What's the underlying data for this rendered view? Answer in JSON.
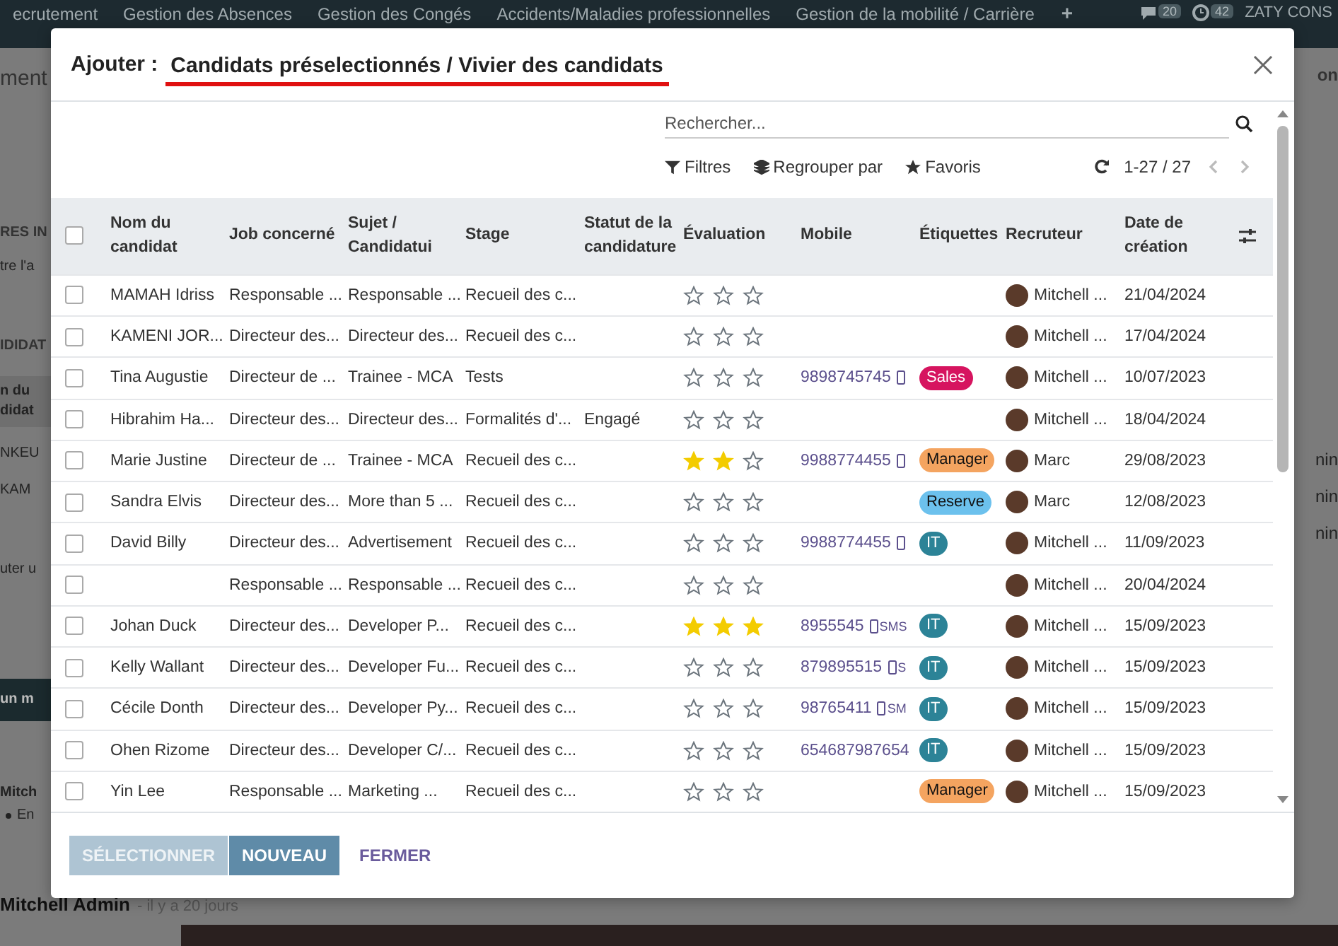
{
  "top_nav": {
    "items": [
      "ecrutement",
      "Gestion des Absences",
      "Gestion des Congés",
      "Accidents/Maladies professionnelles",
      "Gestion de la mobilité / Carrière"
    ],
    "add": "+",
    "messages_count": "20",
    "activities_count": "42",
    "company": "ZATY CONS"
  },
  "background": {
    "left_fragments": [
      {
        "kind": "title",
        "text": "ment"
      },
      {
        "kind": "heading",
        "text": "RES IN"
      },
      {
        "kind": "text",
        "text": "tre l'a"
      },
      {
        "kind": "heading",
        "text": "IDIDAT"
      },
      {
        "kind": "header",
        "text": "n du didat"
      },
      {
        "kind": "text",
        "text": "NKEU"
      },
      {
        "kind": "text",
        "text": "KAM"
      },
      {
        "kind": "text",
        "text": "uter u"
      },
      {
        "kind": "bar",
        "text": "un m"
      },
      {
        "kind": "author",
        "text": "Mitch"
      },
      {
        "kind": "bullet",
        "text": "En"
      }
    ],
    "right_fragments": [
      {
        "kind": "title",
        "text": "on"
      },
      {
        "kind": "text",
        "text": "nin"
      },
      {
        "kind": "text",
        "text": "nin"
      },
      {
        "kind": "text",
        "text": "nin"
      }
    ],
    "footer_author": "Mitchell Admin",
    "footer_time": "- il y a 20 jours"
  },
  "dialog": {
    "title_prefix": "Ajouter :",
    "title": "Candidats préselectionnés / Vivier des candidats",
    "search": {
      "placeholder": "Rechercher..."
    },
    "filters": [
      "Filtres",
      "Regrouper par",
      "Favoris"
    ],
    "pager": "1-27 / 27",
    "table": {
      "all_checked": false,
      "columns": [
        "Nom du candidat",
        "Job concerné",
        "Sujet / Candidatui",
        "Stage",
        "Statut de la candidature",
        "Évaluation",
        "Mobile",
        "Étiquettes",
        "Recruteur",
        "Date de création"
      ],
      "rows": [
        {
          "checked": false,
          "name": "MAMAH Idriss",
          "job": "Responsable ...",
          "subject": "Responsable ...",
          "stage": "Recueil des c...",
          "stars": 0,
          "recruiter": "Mitchell ...",
          "date": "21/04/2024"
        },
        {
          "checked": false,
          "name": "KAMENI JOR...",
          "job": "Directeur des...",
          "subject": "Directeur des...",
          "stage": "Recueil des c...",
          "stars": 0,
          "recruiter": "Mitchell ...",
          "date": "17/04/2024"
        },
        {
          "checked": false,
          "name": "Tina Augustie",
          "job": "Directeur de ...",
          "subject": "Trainee - MCA",
          "stage": "Tests",
          "stars": 0,
          "mobile": "9898745745",
          "phone_icon": true,
          "tag": {
            "label": "Sales",
            "color": "#d6145f"
          },
          "recruiter": "Mitchell ...",
          "date": "10/07/2023"
        },
        {
          "checked": false,
          "name": "Hibrahim Ha...",
          "job": "Directeur des...",
          "subject": "Directeur des...",
          "stage": "Formalités d'...",
          "status": "Engagé",
          "stars": 0,
          "recruiter": "Mitchell ...",
          "date": "18/04/2024"
        },
        {
          "checked": false,
          "name": "Marie Justine",
          "job": "Directeur de ...",
          "subject": "Trainee - MCA",
          "stage": "Recueil des c...",
          "stars": 2,
          "mobile": "9988774455",
          "phone_icon": true,
          "tag": {
            "label": "Manager",
            "color": "#f4a460"
          },
          "recruiter": "Marc",
          "date": "29/08/2023"
        },
        {
          "checked": false,
          "name": "Sandra Elvis",
          "job": "Directeur des...",
          "subject": "More than 5 ...",
          "stage": "Recueil des c...",
          "stars": 0,
          "tag": {
            "label": "Reserve",
            "color": "#6cc1ed"
          },
          "recruiter": "Marc",
          "date": "12/08/2023"
        },
        {
          "checked": false,
          "name": "David Billy",
          "job": "Directeur des...",
          "subject": "Advertisement",
          "stage": "Recueil des c...",
          "stars": 0,
          "mobile": "9988774455",
          "phone_icon": true,
          "tag": {
            "label": "IT",
            "color": "#2c8397"
          },
          "recruiter": "Mitchell ...",
          "date": "11/09/2023"
        },
        {
          "checked": false,
          "job": "Responsable ...",
          "subject": "Responsable ...",
          "stage": "Recueil des c...",
          "stars": 0,
          "recruiter": "Mitchell ...",
          "date": "20/04/2024"
        },
        {
          "checked": false,
          "name": "Johan Duck",
          "job": "Directeur des...",
          "subject": "Developer P...",
          "stage": "Recueil des c...",
          "stars": 3,
          "mobile": "8955545",
          "phone_icon": true,
          "sms": "SMS",
          "tag": {
            "label": "IT",
            "color": "#2c8397"
          },
          "recruiter": "Mitchell ...",
          "date": "15/09/2023"
        },
        {
          "checked": false,
          "name": "Kelly Wallant",
          "job": "Directeur des...",
          "subject": "Developer Fu...",
          "stage": "Recueil des c...",
          "stars": 0,
          "mobile": "879895515",
          "phone_icon": true,
          "sms": "S",
          "tag": {
            "label": "IT",
            "color": "#2c8397"
          },
          "recruiter": "Mitchell ...",
          "date": "15/09/2023"
        },
        {
          "checked": false,
          "name": "Cécile Donth",
          "job": "Directeur des...",
          "subject": "Developer Py...",
          "stage": "Recueil des c...",
          "stars": 0,
          "mobile": "98765411",
          "phone_icon": true,
          "sms": "SM",
          "tag": {
            "label": "IT",
            "color": "#2c8397"
          },
          "recruiter": "Mitchell ...",
          "date": "15/09/2023"
        },
        {
          "checked": false,
          "name": "Ohen Rizome",
          "job": "Directeur des...",
          "subject": "Developer C/...",
          "stage": "Recueil des c...",
          "stars": 0,
          "mobile": "654687987654",
          "phone_icon": false,
          "tag": {
            "label": "IT",
            "color": "#2c8397"
          },
          "recruiter": "Mitchell ...",
          "date": "15/09/2023"
        },
        {
          "checked": false,
          "name": "Yin Lee",
          "job": "Responsable ...",
          "subject": "Marketing ...",
          "stage": "Recueil des c...",
          "stars": 0,
          "tag": {
            "label": "Manager",
            "color": "#f4a460"
          },
          "recruiter": "Mitchell ...",
          "date": "15/09/2023"
        }
      ]
    },
    "buttons": [
      {
        "label": "SÉLECTIONNER",
        "kind": "primary",
        "disabled": true
      },
      {
        "label": "NOUVEAU",
        "kind": "primary",
        "disabled": false
      },
      {
        "label": "FERMER",
        "kind": "link",
        "disabled": false
      }
    ]
  }
}
